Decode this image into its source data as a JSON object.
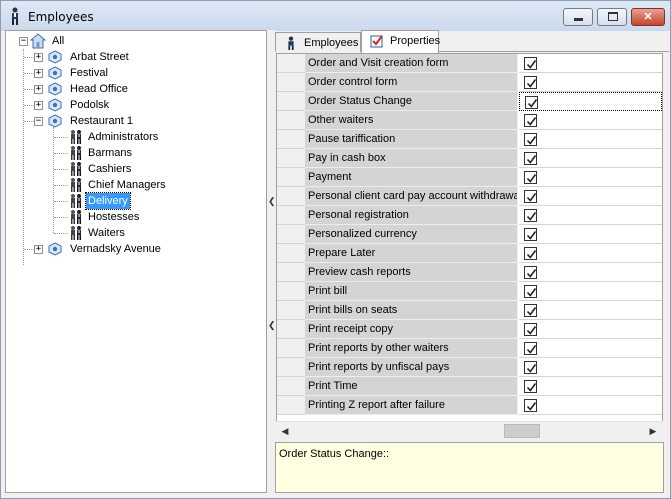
{
  "window": {
    "title": "Employees",
    "controls": {
      "minimize": "minimize",
      "maximize": "maximize",
      "close": "✕"
    }
  },
  "tree": {
    "root": {
      "label": "All"
    },
    "restaurants": [
      {
        "label": "Arbat Street"
      },
      {
        "label": "Festival"
      },
      {
        "label": "Head Office"
      },
      {
        "label": "Podolsk"
      },
      {
        "label": "Restaurant 1"
      },
      {
        "label": "Vernadsky Avenue"
      }
    ],
    "groups": [
      {
        "label": "Administrators"
      },
      {
        "label": "Barmans"
      },
      {
        "label": "Cashiers"
      },
      {
        "label": "Chief Managers"
      },
      {
        "label": "Delivery",
        "selected": true
      },
      {
        "label": "Hostesses"
      },
      {
        "label": "Waiters"
      }
    ]
  },
  "tabs": [
    {
      "label": "Employees",
      "active": false,
      "icon": "person-icon"
    },
    {
      "label": "Properties",
      "active": true,
      "icon": "properties-icon"
    }
  ],
  "properties": [
    {
      "name": "Order and Visit creation form",
      "checked": true
    },
    {
      "name": "Order control form",
      "checked": true
    },
    {
      "name": "Order Status Change",
      "checked": true,
      "focused": true
    },
    {
      "name": "Other waiters",
      "checked": true
    },
    {
      "name": "Pause tariffication",
      "checked": true
    },
    {
      "name": "Pay in cash box",
      "checked": true
    },
    {
      "name": "Payment",
      "checked": true
    },
    {
      "name": "Personal client card pay account withdrawal",
      "checked": true
    },
    {
      "name": "Personal registration",
      "checked": true
    },
    {
      "name": "Personalized currency",
      "checked": true
    },
    {
      "name": "Prepare Later",
      "checked": true
    },
    {
      "name": "Preview cash reports",
      "checked": true
    },
    {
      "name": "Print bill",
      "checked": true
    },
    {
      "name": "Print bills on seats",
      "checked": true
    },
    {
      "name": "Print receipt copy",
      "checked": true
    },
    {
      "name": "Print reports by other waiters",
      "checked": true
    },
    {
      "name": "Print reports by unfiscal pays",
      "checked": true
    },
    {
      "name": "Print Time",
      "checked": true
    },
    {
      "name": "Printing Z report after failure",
      "checked": true
    }
  ],
  "description": {
    "text": "Order Status Change::"
  },
  "colors": {
    "selection": "#3399ff",
    "description_bg": "#ffffe1",
    "property_name_bg": "#d4d4d4"
  }
}
